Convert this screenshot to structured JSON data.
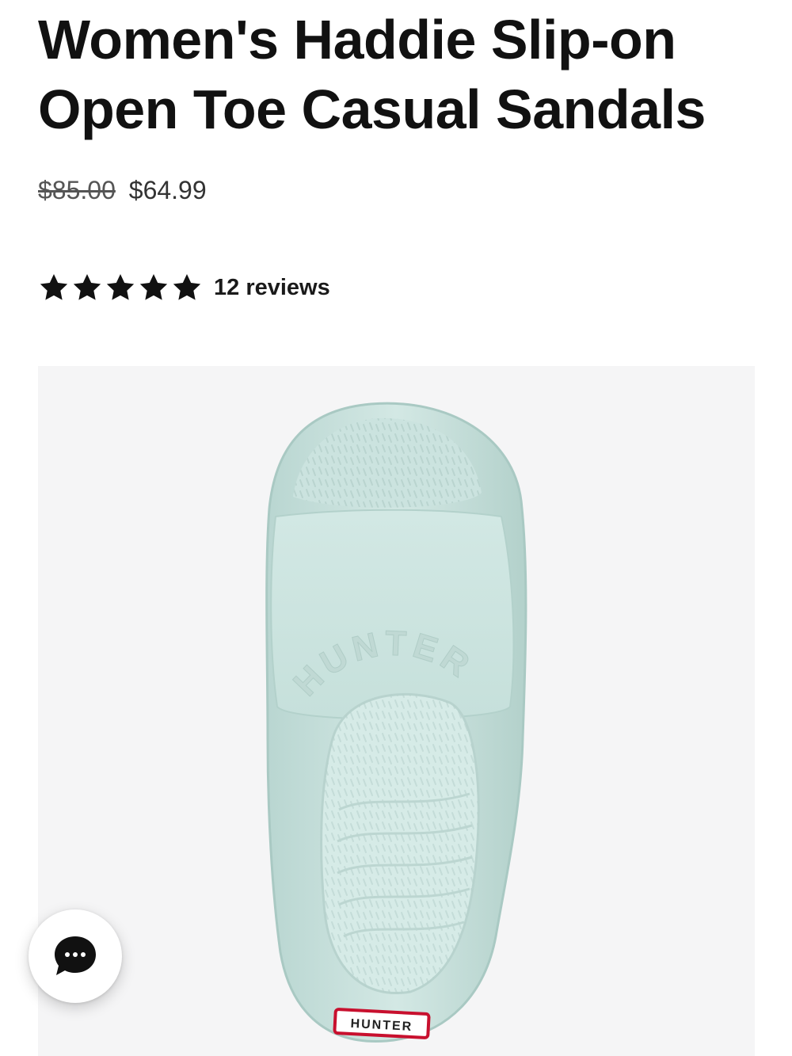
{
  "product": {
    "title": "Women's Haddie Slip-on Open Toe Casual Sandals",
    "original_price": "$85.00",
    "sale_price": "$64.99",
    "rating": {
      "stars_filled": 5,
      "stars_total": 5,
      "reviews_label": "12 reviews"
    },
    "image": {
      "brand_tag_text": "HUNTER",
      "embossed_text": "HUNTER",
      "sandal_color": "#cfe5e1",
      "tag_color": "#c8102e"
    }
  },
  "chat": {
    "icon": "chat-bubble-icon"
  }
}
